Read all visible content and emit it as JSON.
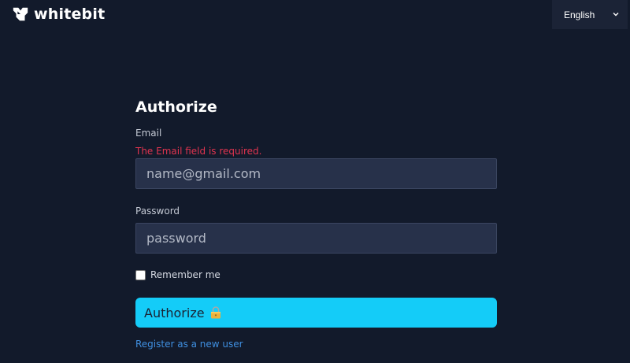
{
  "header": {
    "logo_text": "whitebit",
    "language": {
      "selected": "English"
    }
  },
  "form": {
    "title": "Authorize",
    "email": {
      "label": "Email",
      "error": "The Email field is required.",
      "placeholder": "name@gmail.com",
      "value": ""
    },
    "password": {
      "label": "Password",
      "placeholder": "password",
      "value": ""
    },
    "remember": {
      "label": "Remember me",
      "checked": false
    },
    "submit_label": "Authorize",
    "register_link": "Register as a new user"
  },
  "icons": {
    "logo": "whitebit-logo-icon",
    "language_toggle": "chevron-down-icon",
    "submit": "lock-icon"
  },
  "colors": {
    "background": "#121a2b",
    "accent": "#14ccf8",
    "error": "#e0344f",
    "link": "#3f8fe0",
    "input_bg": "#27314a"
  }
}
